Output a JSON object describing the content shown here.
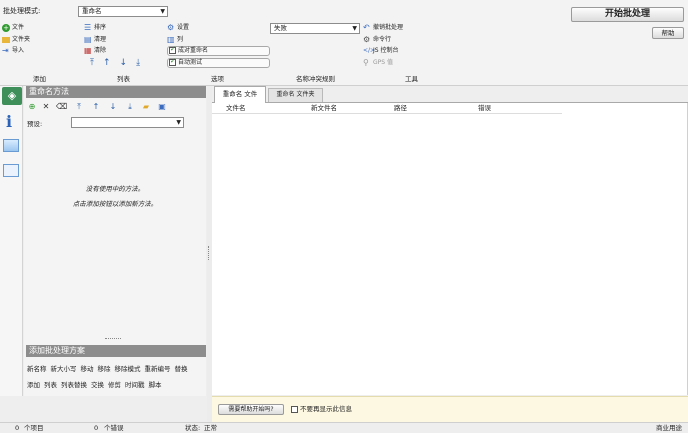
{
  "top": {
    "mode_label": "批处理模式:",
    "mode_value": "重命名",
    "start_button": "开始批处理",
    "help_button": "帮助"
  },
  "add_col": [
    {
      "label": "文件",
      "icon": "add-icon"
    },
    {
      "label": "文件夹",
      "icon": "folder-icon"
    },
    {
      "label": "导入",
      "icon": "import-icon"
    }
  ],
  "list_col": [
    {
      "label": "排序",
      "icon": "sort-icon"
    },
    {
      "label": "清理",
      "icon": "clean-icon"
    },
    {
      "label": "清除",
      "icon": "clear-icon"
    }
  ],
  "options_col": [
    {
      "label": "设置",
      "icon": "settings-icon"
    },
    {
      "label": "列",
      "icon": "columns-icon"
    },
    {
      "label": "成对重命名",
      "checked": true
    },
    {
      "label": "自动测试",
      "checked": true
    }
  ],
  "conflict": {
    "value": "失败"
  },
  "tools_col": [
    {
      "label": "撤销批处理",
      "icon": "undo-icon"
    },
    {
      "label": "命令行",
      "icon": "gear-icon"
    },
    {
      "label": "JS 控制台",
      "icon": "code-icon"
    },
    {
      "label": "GPS 值",
      "icon": "location-icon"
    }
  ],
  "section_headers": [
    "添加",
    "列表",
    "选项",
    "名称冲突规则",
    "工具"
  ],
  "rename_methods": {
    "title": "重命名方法",
    "preset_label": "预设:",
    "empty_line1": "没有使用中的方法。",
    "empty_line2": "点击添加按钮以添加新方法。"
  },
  "tabs": [
    "重命名 文件",
    "重命名 文件夹"
  ],
  "columns": [
    "文件名",
    "新文件名",
    "路径",
    "错误"
  ],
  "batch_scheme": {
    "title": "添加批处理方案",
    "line1": [
      "新名称",
      "新大小写",
      "移动",
      "移除",
      "移除模式",
      "重新编号",
      "替换"
    ],
    "line2": [
      "添加",
      "列表",
      "列表替换",
      "交换",
      "修剪",
      "时间戳",
      "脚本"
    ]
  },
  "info_bar": {
    "help_button": "需要帮助开始吗?",
    "dont_show": "不要再显示此信息"
  },
  "status": {
    "items_count": "0",
    "items_label": "个项目",
    "errors_count": "0",
    "errors_label": "个错误",
    "state_label": "状态:",
    "state_value": "正常",
    "buy": "商业用途"
  },
  "colors": {
    "header_gray": "#8d8d8d",
    "accent_green": "#3a9a3a",
    "info_yellow": "#fdf8e1"
  }
}
